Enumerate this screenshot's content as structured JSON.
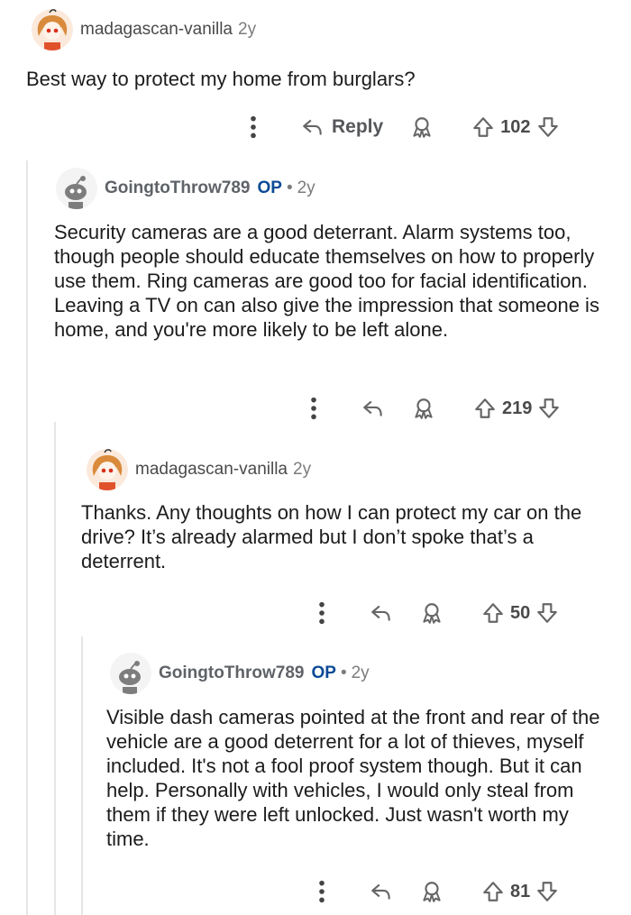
{
  "comments": [
    {
      "author": "madagascan-vanilla",
      "age": "2y",
      "text": "Best way to protect my home from burglars?",
      "reply_label": "Reply",
      "votes": "102"
    },
    {
      "author": "GoingtoThrow789",
      "op_badge": "OP",
      "separator": "•",
      "age": "2y",
      "text": "Security cameras are a good deterrant. Alarm systems too, though people should educate themselves on how to properly use them. Ring cameras are good too for facial identification. Leaving a TV on can also give the impression that someone is home, and you're more likely to be left alone.",
      "votes": "219"
    },
    {
      "author": "madagascan-vanilla",
      "age": "2y",
      "text": "Thanks. Any thoughts on how I can protect my car on the drive? It’s already alarmed but I don’t spoke that’s a deterrent.",
      "votes": "50"
    },
    {
      "author": "GoingtoThrow789",
      "op_badge": "OP",
      "separator": "•",
      "age": "2y",
      "text": "Visible dash cameras pointed at the front and rear of the vehicle are a good deterrent for a lot of thieves, myself included. It's not a fool proof system though. But it can help. Personally with vehicles, I would only steal from them if they were left unlocked. Just wasn't worth my time.",
      "votes": "81"
    }
  ],
  "icons": {
    "more": "more-vertical-icon",
    "reply": "reply-arrow-icon",
    "award": "award-icon",
    "upvote": "upvote-arrow-icon",
    "downvote": "downvote-arrow-icon"
  },
  "colors": {
    "op_badge": "#0a4a96",
    "icon_gray": "#878a8c",
    "thread_line": "#e6e6e6"
  }
}
